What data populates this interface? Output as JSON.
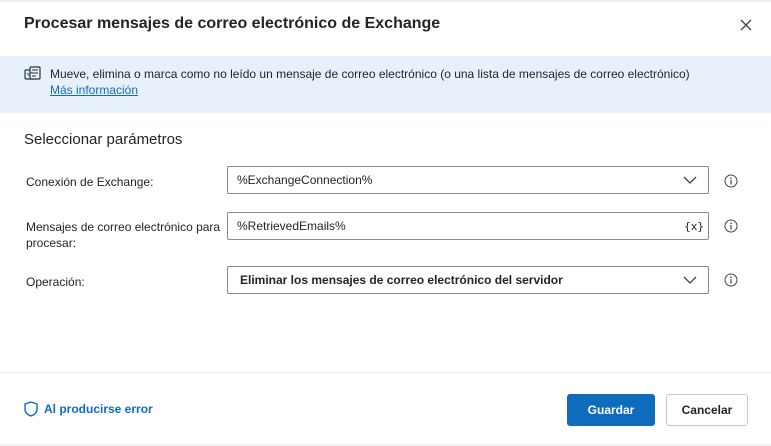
{
  "dialog": {
    "title": "Procesar mensajes de correo electrónico de Exchange",
    "close_icon": "close-icon"
  },
  "info": {
    "icon": "exchange-action-icon",
    "text": "Mueve, elimina o marca como no leído un mensaje de correo electrónico (o una lista de mensajes de correo electrónico)",
    "link": "Más información"
  },
  "parameters": {
    "section_title": "Seleccionar parámetros",
    "fields": [
      {
        "label": "Conexión de Exchange:",
        "value": "%ExchangeConnection%",
        "control": "dropdown"
      },
      {
        "label": "Mensajes de correo electrónico para procesar:",
        "value": "%RetrievedEmails%",
        "control": "variable",
        "variable_button": "{x}"
      },
      {
        "label": "Operación:",
        "value": "Eliminar los mensajes de correo electrónico del servidor",
        "control": "dropdown"
      }
    ]
  },
  "footer": {
    "error_label": "Al producirse error",
    "save_label": "Guardar",
    "cancel_label": "Cancelar"
  },
  "colors": {
    "accent": "#0f6cbd",
    "banner_bg": "#e8f1fb",
    "border": "#8a8a8a"
  }
}
